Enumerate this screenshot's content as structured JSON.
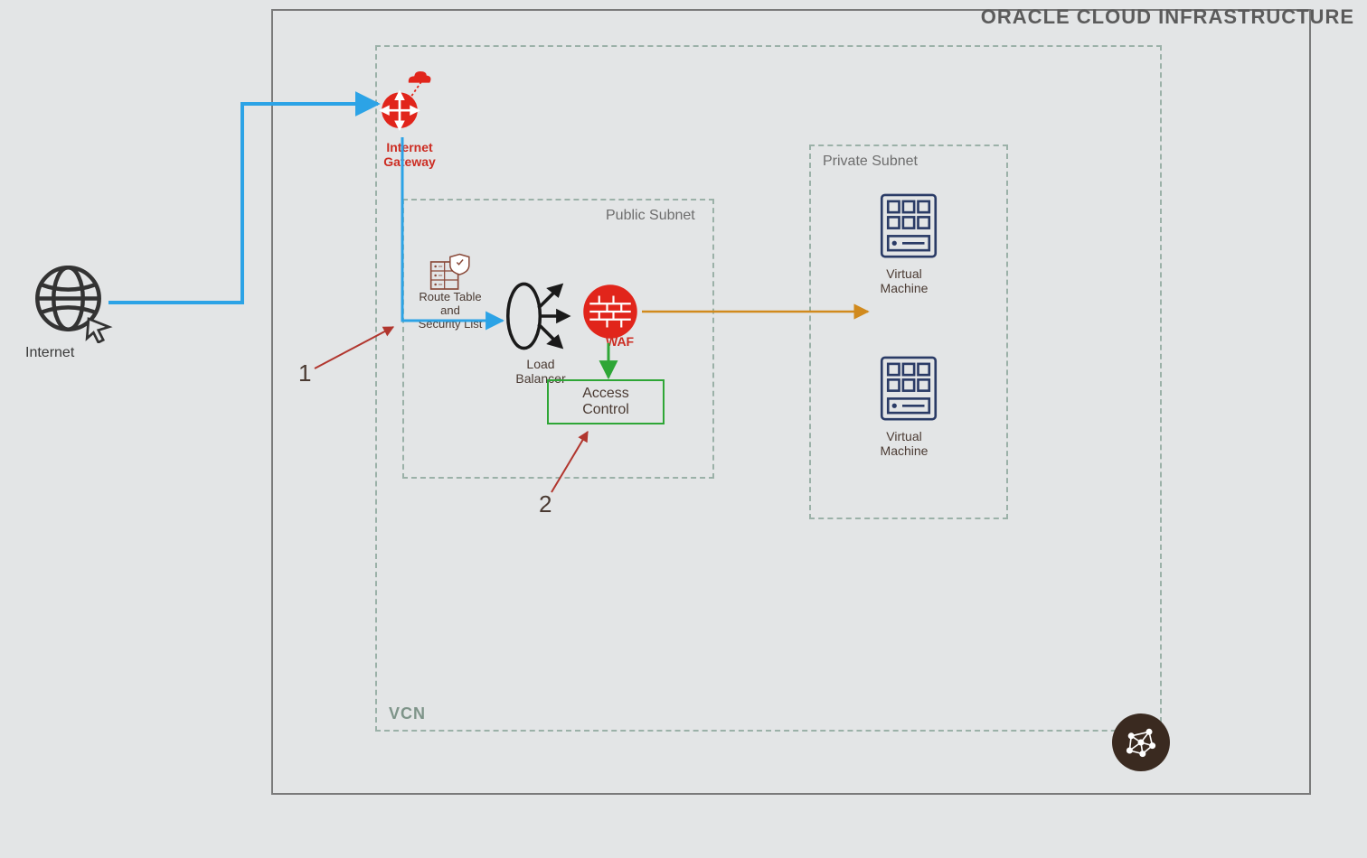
{
  "title": "ORACLE CLOUD INFRASTRUCTURE",
  "vcn_label": "VCN",
  "public_subnet_label": "Public Subnet",
  "private_subnet_label": "Private Subnet",
  "internet_label": "Internet",
  "internet_gateway_label": "Internet\nGateway",
  "route_table_label": "Route Table\nand\nSecurity List",
  "load_balancer_label": "Load\nBalancer",
  "waf_label": "WAF",
  "access_control_label": "Access\nControl",
  "vm1_label": "Virtual\nMachine",
  "vm2_label": "Virtual\nMachine",
  "callouts": {
    "one": "1",
    "two": "2"
  },
  "colors": {
    "oracle_red": "#E1251B",
    "blue_flow": "#2CA3E6",
    "green_flow": "#2EA636",
    "orange_flow": "#D18A1D",
    "red_callout": "#B1362E",
    "dash_border": "#9BB1A8",
    "solid_border": "#7A7A7A",
    "label_dark": "#4A3A32"
  }
}
